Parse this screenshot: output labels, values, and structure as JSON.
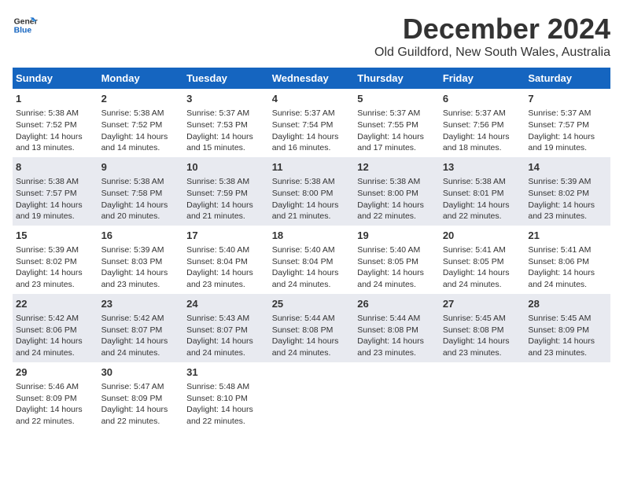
{
  "logo": {
    "line1": "General",
    "line2": "Blue"
  },
  "title": "December 2024",
  "location": "Old Guildford, New South Wales, Australia",
  "headers": [
    "Sunday",
    "Monday",
    "Tuesday",
    "Wednesday",
    "Thursday",
    "Friday",
    "Saturday"
  ],
  "weeks": [
    [
      {
        "day": "1",
        "sunrise": "Sunrise: 5:38 AM",
        "sunset": "Sunset: 7:52 PM",
        "daylight": "Daylight: 14 hours and 13 minutes."
      },
      {
        "day": "2",
        "sunrise": "Sunrise: 5:38 AM",
        "sunset": "Sunset: 7:52 PM",
        "daylight": "Daylight: 14 hours and 14 minutes."
      },
      {
        "day": "3",
        "sunrise": "Sunrise: 5:37 AM",
        "sunset": "Sunset: 7:53 PM",
        "daylight": "Daylight: 14 hours and 15 minutes."
      },
      {
        "day": "4",
        "sunrise": "Sunrise: 5:37 AM",
        "sunset": "Sunset: 7:54 PM",
        "daylight": "Daylight: 14 hours and 16 minutes."
      },
      {
        "day": "5",
        "sunrise": "Sunrise: 5:37 AM",
        "sunset": "Sunset: 7:55 PM",
        "daylight": "Daylight: 14 hours and 17 minutes."
      },
      {
        "day": "6",
        "sunrise": "Sunrise: 5:37 AM",
        "sunset": "Sunset: 7:56 PM",
        "daylight": "Daylight: 14 hours and 18 minutes."
      },
      {
        "day": "7",
        "sunrise": "Sunrise: 5:37 AM",
        "sunset": "Sunset: 7:57 PM",
        "daylight": "Daylight: 14 hours and 19 minutes."
      }
    ],
    [
      {
        "day": "8",
        "sunrise": "Sunrise: 5:38 AM",
        "sunset": "Sunset: 7:57 PM",
        "daylight": "Daylight: 14 hours and 19 minutes."
      },
      {
        "day": "9",
        "sunrise": "Sunrise: 5:38 AM",
        "sunset": "Sunset: 7:58 PM",
        "daylight": "Daylight: 14 hours and 20 minutes."
      },
      {
        "day": "10",
        "sunrise": "Sunrise: 5:38 AM",
        "sunset": "Sunset: 7:59 PM",
        "daylight": "Daylight: 14 hours and 21 minutes."
      },
      {
        "day": "11",
        "sunrise": "Sunrise: 5:38 AM",
        "sunset": "Sunset: 8:00 PM",
        "daylight": "Daylight: 14 hours and 21 minutes."
      },
      {
        "day": "12",
        "sunrise": "Sunrise: 5:38 AM",
        "sunset": "Sunset: 8:00 PM",
        "daylight": "Daylight: 14 hours and 22 minutes."
      },
      {
        "day": "13",
        "sunrise": "Sunrise: 5:38 AM",
        "sunset": "Sunset: 8:01 PM",
        "daylight": "Daylight: 14 hours and 22 minutes."
      },
      {
        "day": "14",
        "sunrise": "Sunrise: 5:39 AM",
        "sunset": "Sunset: 8:02 PM",
        "daylight": "Daylight: 14 hours and 23 minutes."
      }
    ],
    [
      {
        "day": "15",
        "sunrise": "Sunrise: 5:39 AM",
        "sunset": "Sunset: 8:02 PM",
        "daylight": "Daylight: 14 hours and 23 minutes."
      },
      {
        "day": "16",
        "sunrise": "Sunrise: 5:39 AM",
        "sunset": "Sunset: 8:03 PM",
        "daylight": "Daylight: 14 hours and 23 minutes."
      },
      {
        "day": "17",
        "sunrise": "Sunrise: 5:40 AM",
        "sunset": "Sunset: 8:04 PM",
        "daylight": "Daylight: 14 hours and 23 minutes."
      },
      {
        "day": "18",
        "sunrise": "Sunrise: 5:40 AM",
        "sunset": "Sunset: 8:04 PM",
        "daylight": "Daylight: 14 hours and 24 minutes."
      },
      {
        "day": "19",
        "sunrise": "Sunrise: 5:40 AM",
        "sunset": "Sunset: 8:05 PM",
        "daylight": "Daylight: 14 hours and 24 minutes."
      },
      {
        "day": "20",
        "sunrise": "Sunrise: 5:41 AM",
        "sunset": "Sunset: 8:05 PM",
        "daylight": "Daylight: 14 hours and 24 minutes."
      },
      {
        "day": "21",
        "sunrise": "Sunrise: 5:41 AM",
        "sunset": "Sunset: 8:06 PM",
        "daylight": "Daylight: 14 hours and 24 minutes."
      }
    ],
    [
      {
        "day": "22",
        "sunrise": "Sunrise: 5:42 AM",
        "sunset": "Sunset: 8:06 PM",
        "daylight": "Daylight: 14 hours and 24 minutes."
      },
      {
        "day": "23",
        "sunrise": "Sunrise: 5:42 AM",
        "sunset": "Sunset: 8:07 PM",
        "daylight": "Daylight: 14 hours and 24 minutes."
      },
      {
        "day": "24",
        "sunrise": "Sunrise: 5:43 AM",
        "sunset": "Sunset: 8:07 PM",
        "daylight": "Daylight: 14 hours and 24 minutes."
      },
      {
        "day": "25",
        "sunrise": "Sunrise: 5:44 AM",
        "sunset": "Sunset: 8:08 PM",
        "daylight": "Daylight: 14 hours and 24 minutes."
      },
      {
        "day": "26",
        "sunrise": "Sunrise: 5:44 AM",
        "sunset": "Sunset: 8:08 PM",
        "daylight": "Daylight: 14 hours and 23 minutes."
      },
      {
        "day": "27",
        "sunrise": "Sunrise: 5:45 AM",
        "sunset": "Sunset: 8:08 PM",
        "daylight": "Daylight: 14 hours and 23 minutes."
      },
      {
        "day": "28",
        "sunrise": "Sunrise: 5:45 AM",
        "sunset": "Sunset: 8:09 PM",
        "daylight": "Daylight: 14 hours and 23 minutes."
      }
    ],
    [
      {
        "day": "29",
        "sunrise": "Sunrise: 5:46 AM",
        "sunset": "Sunset: 8:09 PM",
        "daylight": "Daylight: 14 hours and 22 minutes."
      },
      {
        "day": "30",
        "sunrise": "Sunrise: 5:47 AM",
        "sunset": "Sunset: 8:09 PM",
        "daylight": "Daylight: 14 hours and 22 minutes."
      },
      {
        "day": "31",
        "sunrise": "Sunrise: 5:48 AM",
        "sunset": "Sunset: 8:10 PM",
        "daylight": "Daylight: 14 hours and 22 minutes."
      },
      null,
      null,
      null,
      null
    ]
  ]
}
